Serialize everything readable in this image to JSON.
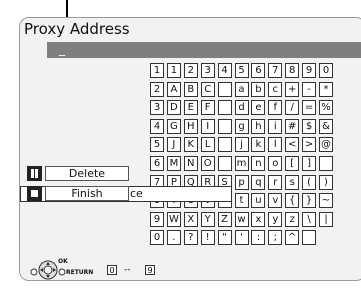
{
  "screen": {
    "title": "Proxy Address",
    "address_value": "_"
  },
  "keyboard": {
    "rows": [
      [
        "1",
        "1",
        "2",
        "3",
        "4",
        "5",
        "6",
        "7",
        "8",
        "9",
        "0"
      ],
      [
        "2",
        "A",
        "B",
        "C",
        "",
        "a",
        "b",
        "c",
        "+",
        "-",
        "*"
      ],
      [
        "3",
        "D",
        "E",
        "F",
        "",
        "d",
        "e",
        "f",
        "/",
        "=",
        "%"
      ],
      [
        "4",
        "G",
        "H",
        "I",
        "",
        "g",
        "h",
        "i",
        "#",
        "$",
        "&"
      ],
      [
        "5",
        "J",
        "K",
        "L",
        "",
        "j",
        "k",
        "l",
        "<",
        ">",
        "@"
      ],
      [
        "6",
        "M",
        "N",
        "O",
        "",
        "m",
        "n",
        "o",
        "[",
        "]",
        ""
      ],
      [
        "7",
        "P",
        "Q",
        "R",
        "S",
        "p",
        "q",
        "r",
        "s",
        "(",
        ")"
      ],
      [
        "8",
        "T",
        "U",
        "V",
        "",
        "t",
        "u",
        "v",
        "{",
        "}",
        "~"
      ],
      [
        "9",
        "W",
        "X",
        "Y",
        "Z",
        "w",
        "x",
        "y",
        "z",
        "\\",
        "|"
      ],
      [
        "0",
        ".",
        "?",
        "!",
        "\"",
        "'",
        ":",
        ";",
        "^",
        ""
      ]
    ],
    "space_label": "Space"
  },
  "actions": {
    "delete_label": "Delete",
    "finish_label": "Finish"
  },
  "remote_hint": {
    "ok_label": "OK",
    "return_label": "RETURN",
    "range_start": "0",
    "range_sep": "--",
    "range_end": "9"
  },
  "icons": [
    "pause-icon",
    "stop-icon",
    "dpad-icon",
    "return-button-icon"
  ],
  "colors": {
    "address_bar": "#7f7f7f",
    "panel_bg": "#f2f2f2"
  }
}
